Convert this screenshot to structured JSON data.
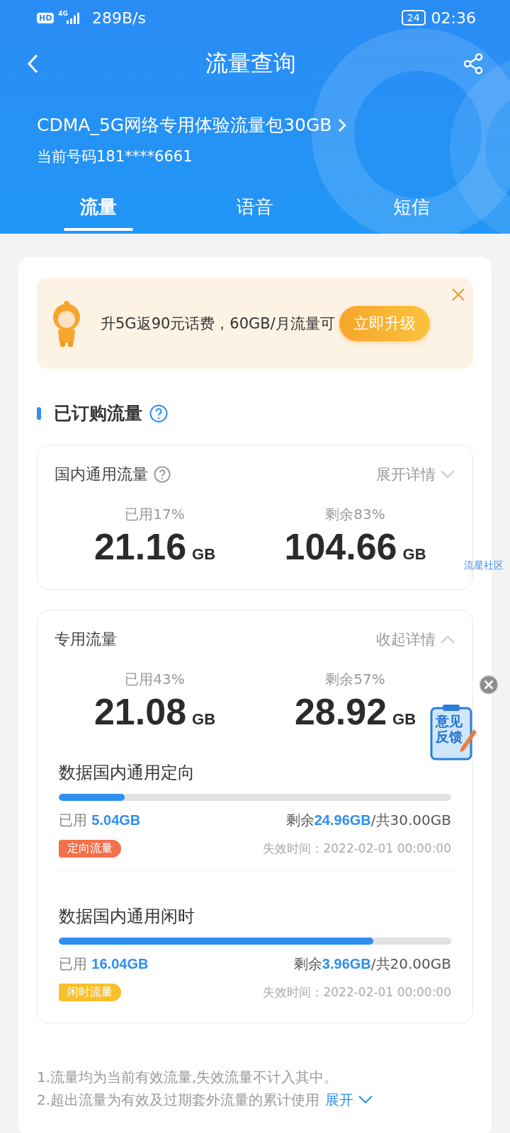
{
  "status_bar": {
    "hd": "HD",
    "network": "4G",
    "speed": "289B/s",
    "battery": "24",
    "time": "02:36"
  },
  "header": {
    "title": "流量查询",
    "package": "CDMA_5G网络专用体验流量包30GB",
    "number": "当前号码181****6661"
  },
  "tabs": [
    {
      "label": "流量",
      "selected": true
    },
    {
      "label": "语音",
      "selected": false
    },
    {
      "label": "短信",
      "selected": false
    }
  ],
  "banner": {
    "text": "升5G返90元话费，60GB/月流量可",
    "button": "立即升级"
  },
  "section_title": "已订购流量",
  "cards": [
    {
      "title": "国内通用流量",
      "help": true,
      "toggle": "展开详情",
      "expanded": false,
      "used_label": "已用17%",
      "used_value": "21.16",
      "used_unit": "GB",
      "remaining_label": "剩余83%",
      "remaining_value": "104.66",
      "remaining_unit": "GB"
    },
    {
      "title": "专用流量",
      "help": false,
      "toggle": "收起详情",
      "expanded": true,
      "used_label": "已用43%",
      "used_value": "21.08",
      "used_unit": "GB",
      "remaining_label": "剩余57%",
      "remaining_value": "28.92",
      "remaining_unit": "GB",
      "items": [
        {
          "name": "数据国内通用定向",
          "level": 0.168,
          "used_label": "已用",
          "used_value": "5.04GB",
          "remaining_label": "剩余",
          "remaining_value": "24.96GB",
          "total": "/共30.00GB",
          "tag": "定向流量",
          "color": "#f2704a",
          "expiry": "失效时间：2022-02-01 00:00:00"
        },
        {
          "name": "数据国内通用闲时",
          "level": 0.802,
          "used_label": "已用",
          "used_value": "16.04GB",
          "remaining_label": "剩余",
          "remaining_value": "3.96GB",
          "total": "/共20.00GB",
          "tag": "闲时流量",
          "color": "#f8c12c",
          "expiry": "失效时间：2022-02-01 00:00:00"
        }
      ]
    }
  ],
  "notes": [
    "1.流量均为当前有效流量,失效流量不计入其中。",
    "2.超出流量为有效及过期套外流量的累计使用"
  ],
  "notes_toggle": "展开",
  "community_link": "流星社区",
  "feedback": "意见反馈"
}
